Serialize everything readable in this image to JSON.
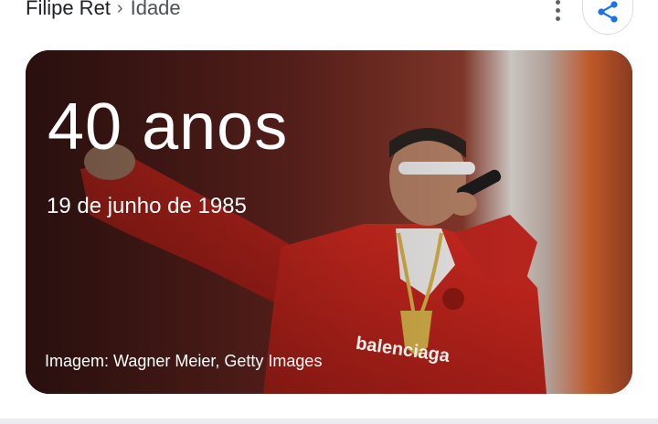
{
  "breadcrumb": {
    "entity": "Filipe Ret",
    "separator": "›",
    "attribute": "Idade"
  },
  "card": {
    "age": "40 anos",
    "birth_date": "19 de junho de 1985",
    "image_credit": "Imagem: Wagner Meier, Getty Images",
    "photo_subject": "performer with microphone in red jacket",
    "jacket_print": "balenciaga"
  },
  "icons": {
    "more": "more-vert-icon",
    "share": "share-icon"
  },
  "colors": {
    "accent": "#1a73e8",
    "text": "#202124",
    "muted": "#5f6368",
    "jacket": "#c8261e"
  }
}
